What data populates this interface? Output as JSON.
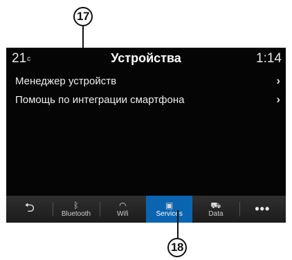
{
  "callouts": {
    "top": "17",
    "bottom": "18"
  },
  "status": {
    "temp": "21",
    "temp_unit": "c",
    "title": "Устройства",
    "time": "1:14"
  },
  "menu": [
    {
      "label": "Менеджер устройств",
      "chevron": "›"
    },
    {
      "label": "Помощь по интеграции смартфона",
      "chevron": "›"
    }
  ],
  "nav": {
    "back": {
      "icon": "back-arrow-icon",
      "glyph": "⮌"
    },
    "bluetooth": {
      "label": "Bluetooth",
      "icon": "bluetooth-icon",
      "glyph": "ᛒ"
    },
    "wifi": {
      "label": "Wifi",
      "icon": "wifi-icon",
      "glyph": "◠"
    },
    "services": {
      "label": "Services",
      "icon": "services-icon",
      "glyph": "▣"
    },
    "data": {
      "label": "Data",
      "icon": "car-data-icon",
      "glyph": "⛟"
    },
    "more": {
      "icon": "more-icon",
      "glyph": "•••"
    }
  },
  "colors": {
    "screen_bg": "#050505",
    "navbar": "#2a2a2a",
    "active_tab": "#0b64b0"
  }
}
